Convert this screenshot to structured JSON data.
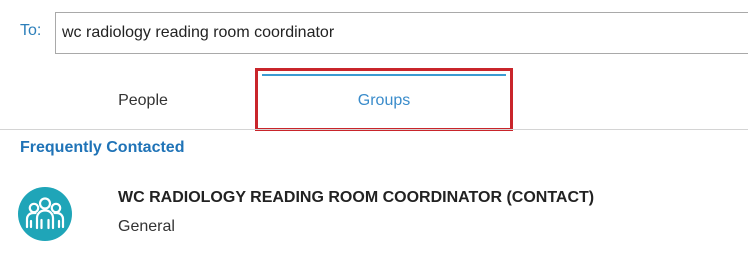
{
  "recipient": {
    "to_label": "To:",
    "value": "wc radiology reading room coordinator"
  },
  "tabs": [
    {
      "label": "People"
    },
    {
      "label": "Groups"
    }
  ],
  "section": {
    "title": "Frequently Contacted"
  },
  "contact": {
    "name": "WC RADIOLOGY READING ROOM COORDINATOR (CONTACT)",
    "subtitle": "General",
    "icon": "group-avatar-icon"
  },
  "colors": {
    "accent": "#3a8ccb",
    "section_title": "#1f73b7",
    "avatar": "#1fa5b8",
    "highlight": "#c9252b"
  }
}
